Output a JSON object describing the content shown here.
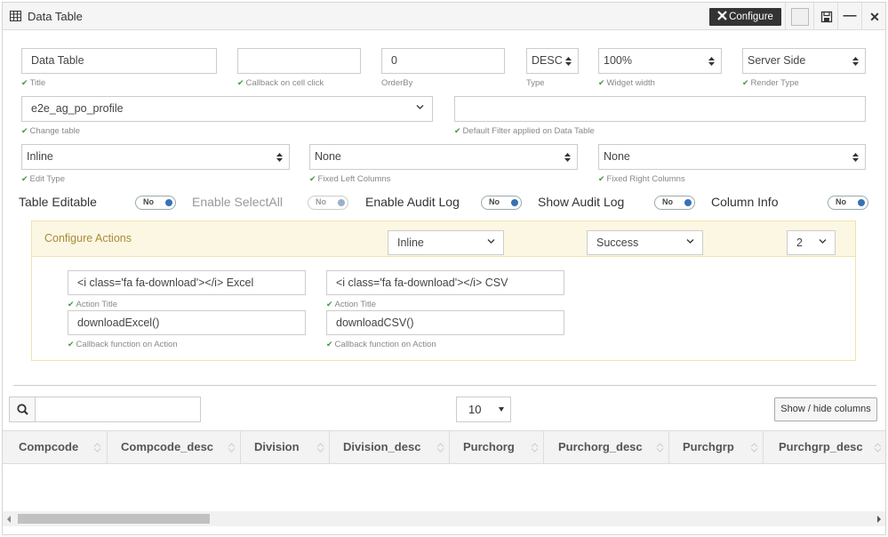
{
  "header": {
    "title": "Data Table",
    "title_icon": "table-icon",
    "configure_label": "Configure",
    "configure_icon": "wrench-icon"
  },
  "config": {
    "title": {
      "value": "Data Table",
      "hint": "Title"
    },
    "callback": {
      "value": "",
      "hint": "Callback on cell click"
    },
    "order_by": {
      "value": "0",
      "hint": "OrderBy"
    },
    "type": {
      "value": "DESC",
      "hint": "Type"
    },
    "widget_width": {
      "value": "100%",
      "hint": "Widget width"
    },
    "render_type": {
      "value": "Server Side",
      "hint": "Render Type"
    },
    "change_table": {
      "value": "e2e_ag_po_profile",
      "hint": "Change table"
    },
    "default_filter": {
      "value": "",
      "hint": "Default Filter applied on Data Table"
    },
    "edit_type": {
      "value": "Inline",
      "hint": "Edit Type"
    },
    "fixed_left": {
      "value": "None",
      "hint": "Fixed Left Columns"
    },
    "fixed_right": {
      "value": "None",
      "hint": "Fixed Right Columns"
    }
  },
  "toggles": [
    {
      "label": "Table Editable",
      "state": "No",
      "disabled": false
    },
    {
      "label": "Enable SelectAll",
      "state": "No",
      "disabled": true
    },
    {
      "label": "Enable Audit Log",
      "state": "No",
      "disabled": false
    },
    {
      "label": "Show Audit Log",
      "state": "No",
      "disabled": false
    },
    {
      "label": "Column Info",
      "state": "No",
      "disabled": false
    }
  ],
  "actions": {
    "title": "Configure Actions",
    "mode": "Inline",
    "style": "Success",
    "count": "2",
    "items": [
      {
        "title": "<i class='fa fa-download'></i> Excel",
        "title_hint": "Action Title",
        "callback": "downloadExcel()",
        "callback_hint": "Callback function on Action"
      },
      {
        "title": "<i class='fa fa-download'></i> CSV",
        "title_hint": "Action Title",
        "callback": "downloadCSV()",
        "callback_hint": "Callback function on Action"
      }
    ]
  },
  "table": {
    "search_placeholder": "",
    "page_size": "10",
    "colvis_label": "Show / hide columns",
    "columns": [
      "Compcode",
      "Compcode_desc",
      "Division",
      "Division_desc",
      "Purchorg",
      "Purchorg_desc",
      "Purchgrp",
      "Purchgrp_desc"
    ],
    "rows": []
  },
  "colors": {
    "accent": "#3672b7",
    "actions_header_bg": "#fcf7e3",
    "actions_title": "#a88b3a",
    "check": "#3c9a3c",
    "configure_bg": "#333333"
  }
}
